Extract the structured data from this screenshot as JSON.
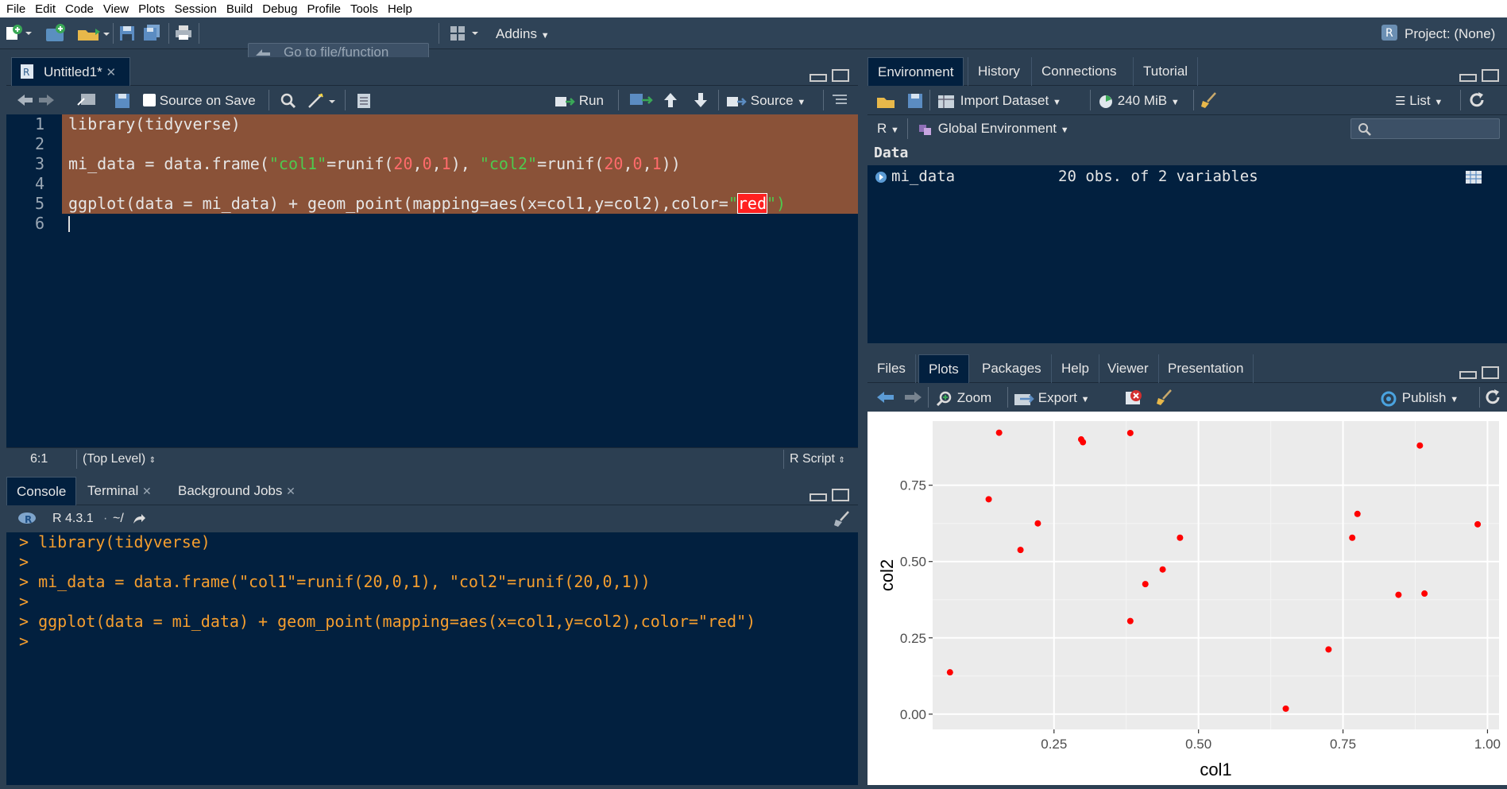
{
  "menu": [
    "File",
    "Edit",
    "Code",
    "View",
    "Plots",
    "Session",
    "Build",
    "Debug",
    "Profile",
    "Tools",
    "Help"
  ],
  "toolbar": {
    "goto_placeholder": "Go to file/function",
    "addins": "Addins",
    "project": "Project: (None)"
  },
  "editor": {
    "tab_label": "Untitled1*",
    "source_on_save": "Source on Save",
    "run": "Run",
    "source": "Source",
    "line_numbers": [
      "1",
      "2",
      "3",
      "4",
      "5",
      "6"
    ],
    "status_pos": "6:1",
    "status_scope": "(Top Level)",
    "status_type": "R Script",
    "code": {
      "l1": "library(tidyverse)",
      "l3a": "mi_data = data.frame(",
      "l3b": "\"col1\"",
      "l3c": "=runif(",
      "l3d": "20",
      "l3e": ",",
      "l3f": "0",
      "l3g": ",",
      "l3h": "1",
      "l3i": "), ",
      "l3j": "\"col2\"",
      "l3k": "=runif(",
      "l3l": "20",
      "l3m": ",",
      "l3n": "0",
      "l3o": ",",
      "l3p": "1",
      "l3q": "))",
      "l5a": "ggplot(data = mi_data) + geom_point(mapping=aes(x=col1,y=col2),color=",
      "l5b": "\"",
      "l5c": "red",
      "l5d": "\")"
    }
  },
  "console": {
    "tabs": [
      "Console",
      "Terminal",
      "Background Jobs"
    ],
    "r_version": "R 4.3.1",
    "path": "~/",
    "lines": [
      "> library(tidyverse)",
      ">",
      "> mi_data = data.frame(\"col1\"=runif(20,0,1), \"col2\"=runif(20,0,1))",
      ">",
      "> ggplot(data = mi_data) + geom_point(mapping=aes(x=col1,y=col2),color=\"red\")",
      ">"
    ]
  },
  "env": {
    "tabs": [
      "Environment",
      "History",
      "Connections",
      "Tutorial"
    ],
    "import_dataset": "Import Dataset",
    "memory": "240 MiB",
    "list": "List",
    "lang": "R",
    "scope": "Global Environment",
    "section": "Data",
    "var_name": "mi_data",
    "var_desc": "20 obs. of 2 variables"
  },
  "files": {
    "tabs": [
      "Files",
      "Plots",
      "Packages",
      "Help",
      "Viewer",
      "Presentation"
    ],
    "zoom": "Zoom",
    "export": "Export",
    "publish": "Publish"
  },
  "chart_data": {
    "type": "scatter",
    "xlabel": "col1",
    "ylabel": "col2",
    "xlim": [
      0.04,
      1.02
    ],
    "ylim": [
      -0.05,
      0.96
    ],
    "xticks": [
      0.25,
      0.5,
      0.75,
      1.0
    ],
    "xtick_labels": [
      "0.25",
      "0.50",
      "0.75",
      "1.00"
    ],
    "yticks": [
      0,
      0.25,
      0.5,
      0.75
    ],
    "ytick_labels": [
      "0.00",
      "0.25",
      "0.50",
      "0.75"
    ],
    "grid": true,
    "color": "#ff0000",
    "points": [
      {
        "x": 0.07,
        "y": 0.137
      },
      {
        "x": 0.137,
        "y": 0.704
      },
      {
        "x": 0.155,
        "y": 0.922
      },
      {
        "x": 0.192,
        "y": 0.538
      },
      {
        "x": 0.222,
        "y": 0.625
      },
      {
        "x": 0.297,
        "y": 0.9
      },
      {
        "x": 0.3,
        "y": 0.891
      },
      {
        "x": 0.382,
        "y": 0.921
      },
      {
        "x": 0.382,
        "y": 0.305
      },
      {
        "x": 0.408,
        "y": 0.426
      },
      {
        "x": 0.438,
        "y": 0.474
      },
      {
        "x": 0.468,
        "y": 0.578
      },
      {
        "x": 0.651,
        "y": 0.018
      },
      {
        "x": 0.725,
        "y": 0.212
      },
      {
        "x": 0.766,
        "y": 0.578
      },
      {
        "x": 0.775,
        "y": 0.656
      },
      {
        "x": 0.846,
        "y": 0.391
      },
      {
        "x": 0.883,
        "y": 0.88
      },
      {
        "x": 0.891,
        "y": 0.395
      },
      {
        "x": 0.983,
        "y": 0.622
      }
    ]
  }
}
